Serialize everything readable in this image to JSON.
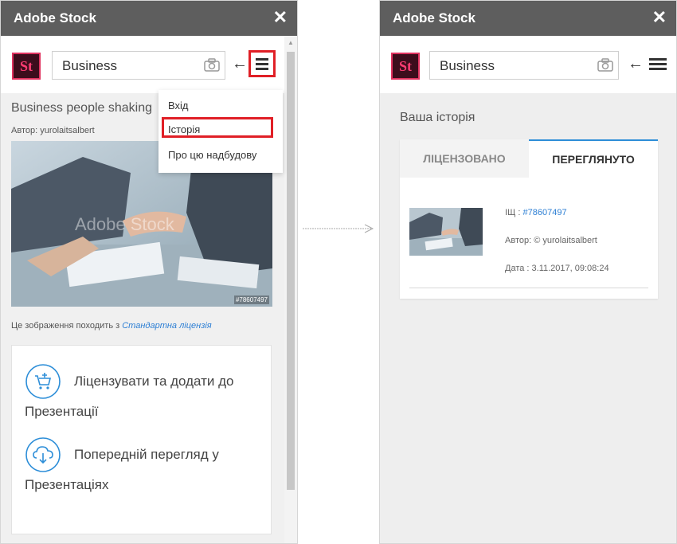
{
  "left_panel": {
    "title": "Adobe Stock",
    "close": "✕",
    "logo": "St",
    "search_value": "Business",
    "back_icon": "arrow-left-icon",
    "menu_icon": "hamburger-menu-icon",
    "image_title": "Business people shaking",
    "author": "Автор: yurolaitsalbert",
    "image_watermark": "Adobe Stock",
    "image_id_tag": "#78607497",
    "license_prefix": "Це зображення походить з",
    "license_link": "Стандартна ліцензія",
    "actions": [
      {
        "icon": "cart-plus-icon",
        "line1": "Ліцензувати та додати до",
        "line2": "Презентації"
      },
      {
        "icon": "cloud-download-icon",
        "line1": "Попередній перегляд у",
        "line2": "Презентаціях"
      }
    ],
    "menu": {
      "items": [
        "Вхід",
        "Історія",
        "Про цю надбудову"
      ]
    },
    "highlight_color": "#e01f26"
  },
  "right_panel": {
    "title": "Adobe Stock",
    "close": "✕",
    "logo": "St",
    "search_value": "Business",
    "heading": "Ваша історія",
    "tabs": [
      {
        "label": "ЛІЦЕНЗОВАНО",
        "active": false
      },
      {
        "label": "ПЕРЕГЛЯНУТО",
        "active": true
      }
    ],
    "history_item": {
      "id_label": "ІЩ :",
      "id_value": "#78607497",
      "author": "Автор: © yurolaitsalbert",
      "date": "Дата : 3.11.2017, 09:08:24"
    },
    "accent_color": "#2d8ed8",
    "link_color": "#2d7fd4"
  }
}
